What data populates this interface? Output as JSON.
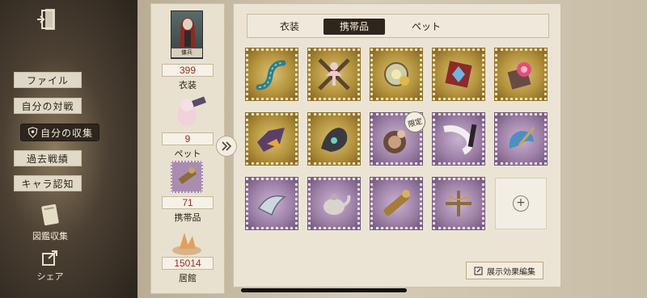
{
  "sidebar": {
    "nav": [
      {
        "label": "ファイル",
        "active": false
      },
      {
        "label": "自分の対戦",
        "active": false
      },
      {
        "label": "自分の収集",
        "active": true
      },
      {
        "label": "過去戦績",
        "active": false
      },
      {
        "label": "キャラ認知",
        "active": false
      }
    ],
    "links": [
      {
        "label": "図鑑収集",
        "icon": "book-icon"
      },
      {
        "label": "シェア",
        "icon": "share-icon"
      }
    ]
  },
  "stats": {
    "card_label": "傭兵",
    "costumes": {
      "count": "399",
      "label": "衣装"
    },
    "pets": {
      "count": "9",
      "label": "ペット"
    },
    "accessories": {
      "count": "71",
      "label": "携帯品"
    },
    "residence": {
      "count": "15014",
      "label": "居館"
    }
  },
  "tabs": [
    {
      "label": "衣装",
      "active": false
    },
    {
      "label": "携帯品",
      "active": true
    },
    {
      "label": "ペット",
      "active": false
    }
  ],
  "items": [
    {
      "rarity": "gold",
      "icon": "tentacle-icon"
    },
    {
      "rarity": "gold",
      "icon": "ballerina-icon"
    },
    {
      "rarity": "gold",
      "icon": "clockwork-icon"
    },
    {
      "rarity": "gold",
      "icon": "gem-box-icon"
    },
    {
      "rarity": "gold",
      "icon": "pink-orb-icon"
    },
    {
      "rarity": "gold",
      "icon": "bat-wing-icon"
    },
    {
      "rarity": "gold",
      "icon": "dragon-icon"
    },
    {
      "rarity": "purple",
      "icon": "monkey-drum-icon",
      "tag": "限定"
    },
    {
      "rarity": "purple",
      "icon": "white-scarf-icon"
    },
    {
      "rarity": "purple",
      "icon": "blue-shell-icon"
    },
    {
      "rarity": "purple",
      "icon": "silver-horn-icon"
    },
    {
      "rarity": "purple",
      "icon": "teapot-icon"
    },
    {
      "rarity": "purple",
      "icon": "brass-telescope-icon"
    },
    {
      "rarity": "purple",
      "icon": "crossbow-icon"
    },
    {
      "rarity": "empty",
      "icon": "plus-icon"
    }
  ],
  "edit_button": "展示効果編集",
  "colors": {
    "active_tab": "#2e261d",
    "count_text": "#9a2a1f",
    "panel_bg": "#ebe4d4"
  }
}
